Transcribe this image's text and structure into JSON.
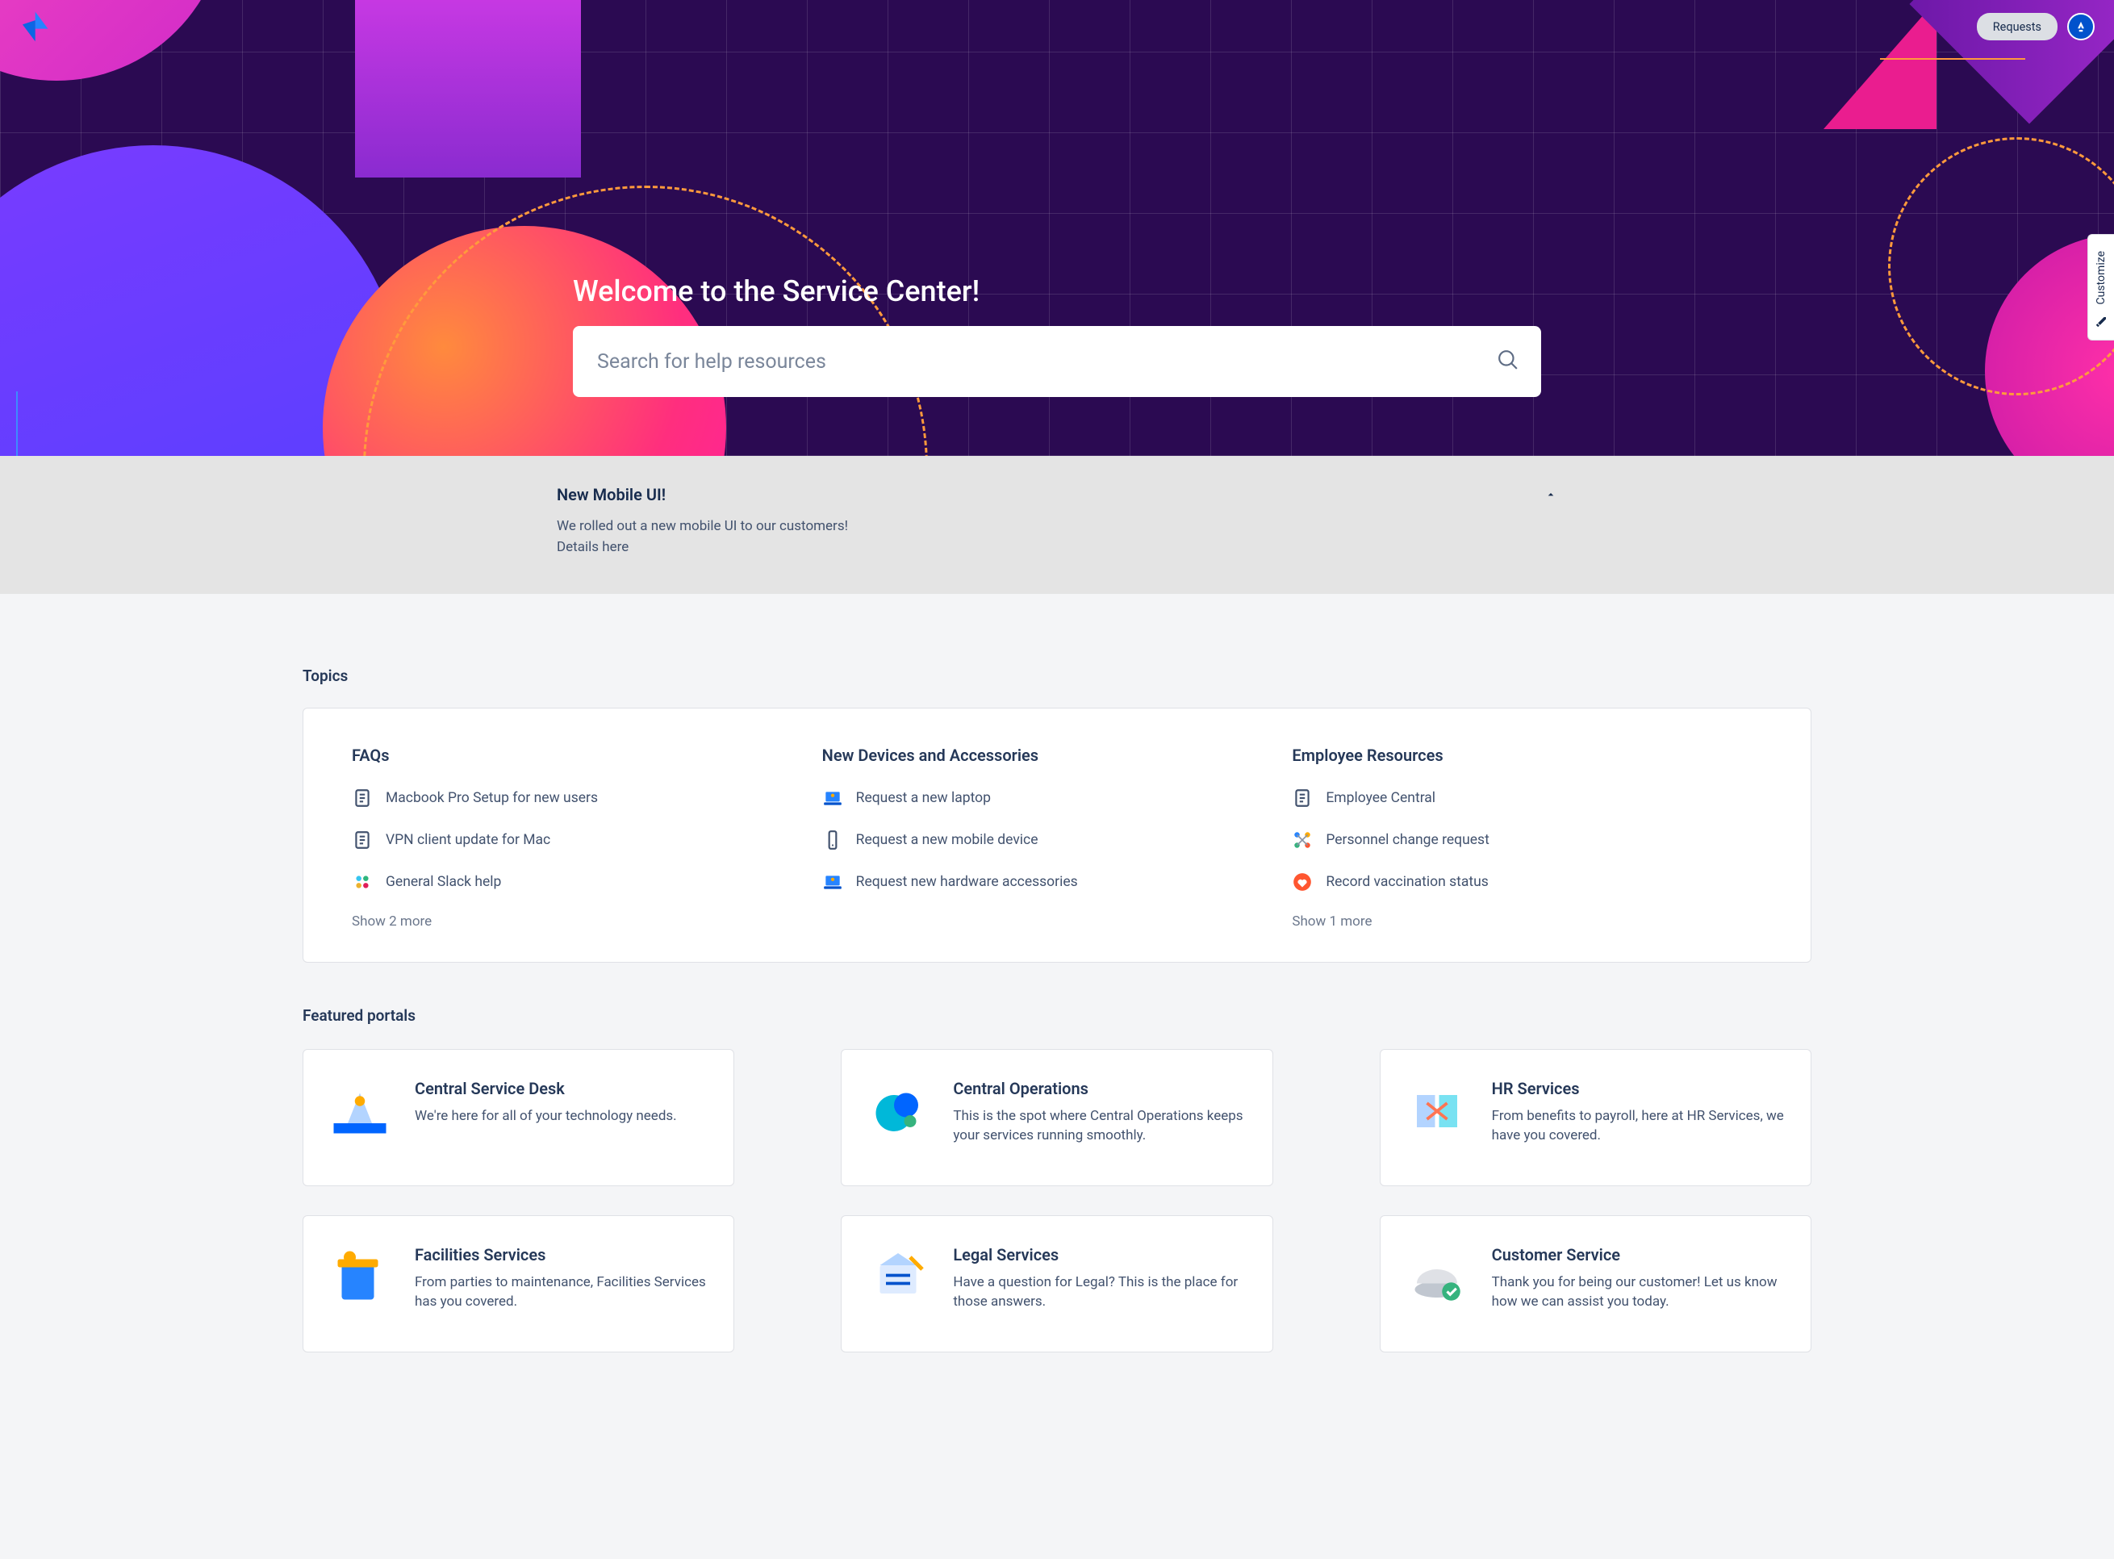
{
  "header": {
    "requests_label": "Requests"
  },
  "hero": {
    "welcome": "Welcome to the Service Center!",
    "search_placeholder": "Search for help resources"
  },
  "customize_label": "Customize",
  "announcement": {
    "title": "New Mobile UI!",
    "line1": "We rolled out a new mobile UI to our customers!",
    "line2": "Details here"
  },
  "topics_section_title": "Topics",
  "topics": [
    {
      "title": "FAQs",
      "items": [
        {
          "icon": "page",
          "label": "Macbook Pro Setup for new users"
        },
        {
          "icon": "page",
          "label": "VPN client update for Mac"
        },
        {
          "icon": "slack",
          "label": "General Slack help"
        }
      ],
      "show_more": "Show 2 more"
    },
    {
      "title": "New Devices and Accessories",
      "items": [
        {
          "icon": "laptop",
          "label": "Request a new laptop"
        },
        {
          "icon": "phone",
          "label": "Request a new mobile device"
        },
        {
          "icon": "laptop",
          "label": "Request new hardware accessories"
        }
      ],
      "show_more": ""
    },
    {
      "title": "Employee Resources",
      "items": [
        {
          "icon": "page",
          "label": "Employee Central"
        },
        {
          "icon": "nodes",
          "label": "Personnel change request"
        },
        {
          "icon": "heart",
          "label": "Record vaccination status"
        }
      ],
      "show_more": "Show 1 more"
    }
  ],
  "portals_section_title": "Featured portals",
  "portals": [
    {
      "title": "Central Service Desk",
      "desc": "We're here for all of your technology needs."
    },
    {
      "title": "Central Operations",
      "desc": "This is the spot where Central Operations keeps your services running smoothly."
    },
    {
      "title": "HR Services",
      "desc": "From benefits to payroll, here at HR Services, we have you covered."
    },
    {
      "title": "Facilities Services",
      "desc": "From parties to maintenance, Facilities Services has you covered."
    },
    {
      "title": "Legal Services",
      "desc": "Have a question for Legal? This is the place for those answers."
    },
    {
      "title": "Customer Service",
      "desc": "Thank you for being our customer! Let us know how we can assist you today."
    }
  ]
}
